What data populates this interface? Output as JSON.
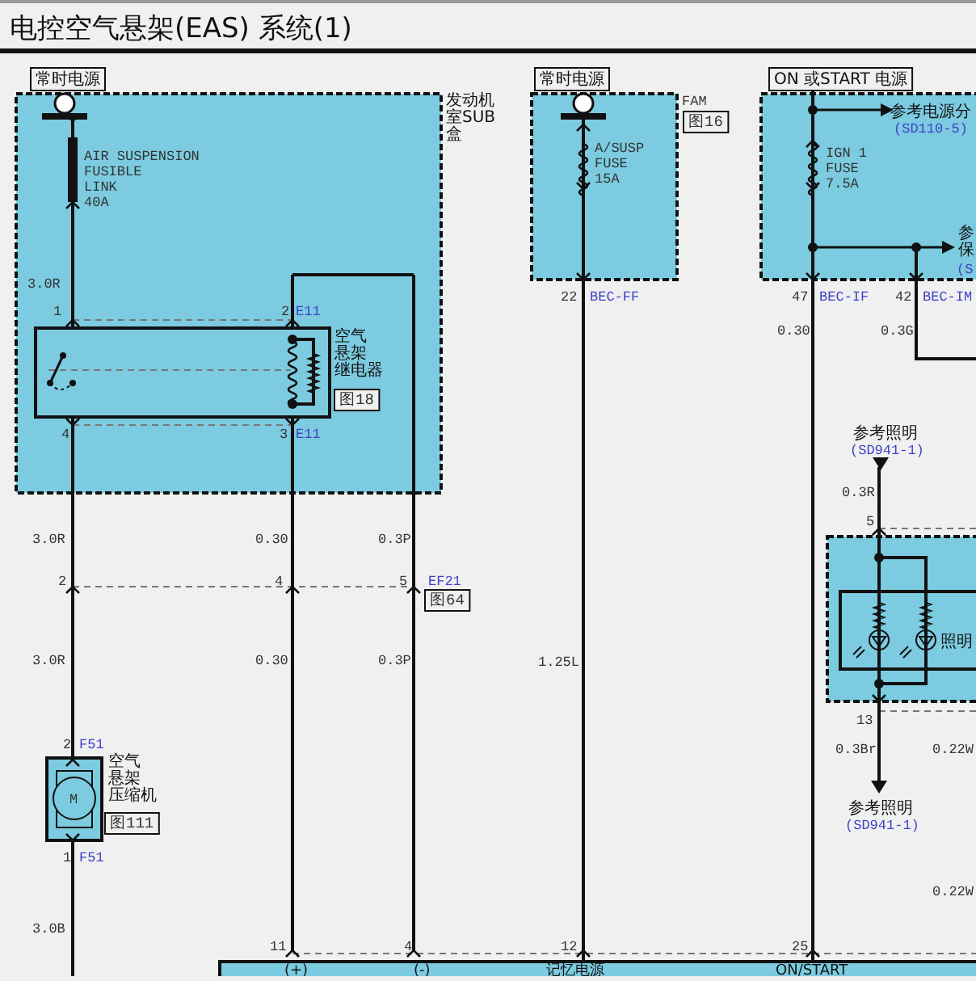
{
  "title": "电控空气悬架(EAS)  系统(1)",
  "labels": [
    {
      "kind": "power",
      "text": "常时电源"
    },
    {
      "kind": "power",
      "text": "常时电源"
    },
    {
      "kind": "power",
      "text": "ON 或START 电源"
    },
    {
      "kind": "part",
      "lines": [
        "发动机",
        "室SUB",
        "盒"
      ]
    },
    {
      "kind": "note",
      "text": "FAM"
    },
    {
      "kind": "ref",
      "text": "图16"
    },
    {
      "kind": "link",
      "text": "参考电源分"
    },
    {
      "kind": "connector",
      "text": "(SD110-5)"
    },
    {
      "kind": "note",
      "lines": [
        "AIR SUSPENSION",
        "FUSIBLE",
        "LINK",
        "40A"
      ]
    },
    {
      "kind": "note",
      "lines": [
        "A/SUSP",
        "FUSE",
        "15A"
      ]
    },
    {
      "kind": "note",
      "lines": [
        "IGN 1",
        "FUSE",
        "7.5A"
      ]
    },
    {
      "kind": "link",
      "lines": [
        "参",
        "保"
      ]
    },
    {
      "kind": "connector",
      "text": "(S"
    },
    {
      "kind": "gauge",
      "text": "3.0R"
    },
    {
      "kind": "pin",
      "text": "1"
    },
    {
      "kind": "pin",
      "text": "2"
    },
    {
      "kind": "connector",
      "text": "E11"
    },
    {
      "kind": "part",
      "lines": [
        "空气",
        "悬架",
        "继电器"
      ]
    },
    {
      "kind": "ref",
      "text": "图18"
    },
    {
      "kind": "pin",
      "text": "22"
    },
    {
      "kind": "connector",
      "text": "BEC-FF"
    },
    {
      "kind": "pin",
      "text": "47"
    },
    {
      "kind": "connector",
      "text": "BEC-IF"
    },
    {
      "kind": "pin",
      "text": "42"
    },
    {
      "kind": "connector",
      "text": "BEC-IM"
    },
    {
      "kind": "gauge",
      "text": "0.30"
    },
    {
      "kind": "gauge",
      "text": "0.3G"
    },
    {
      "kind": "pin",
      "text": "4"
    },
    {
      "kind": "pin",
      "text": "3"
    },
    {
      "kind": "connector",
      "text": "E11"
    },
    {
      "kind": "link",
      "text": "参考照明"
    },
    {
      "kind": "connector",
      "text": "(SD941-1)"
    },
    {
      "kind": "gauge",
      "text": "0.3R"
    },
    {
      "kind": "pin",
      "text": "5"
    },
    {
      "kind": "gauge",
      "text": "3.0R"
    },
    {
      "kind": "gauge",
      "text": "0.30"
    },
    {
      "kind": "gauge",
      "text": "0.3P"
    },
    {
      "kind": "pin",
      "text": "2"
    },
    {
      "kind": "pin",
      "text": "4"
    },
    {
      "kind": "pin",
      "text": "5"
    },
    {
      "kind": "connector",
      "text": "EF21"
    },
    {
      "kind": "ref",
      "text": "图64"
    },
    {
      "kind": "part",
      "text": "照明"
    },
    {
      "kind": "gauge",
      "text": "3.0R"
    },
    {
      "kind": "gauge",
      "text": "0.30"
    },
    {
      "kind": "gauge",
      "text": "0.3P"
    },
    {
      "kind": "gauge",
      "text": "1.25L"
    },
    {
      "kind": "pin",
      "text": "13"
    },
    {
      "kind": "pin",
      "text": "2"
    },
    {
      "kind": "connector",
      "text": "F51"
    },
    {
      "kind": "gauge",
      "text": "0.3Br"
    },
    {
      "kind": "gauge",
      "text": "0.22W"
    },
    {
      "kind": "motor",
      "text": "M"
    },
    {
      "kind": "part",
      "lines": [
        "空气",
        "悬架",
        "压缩机"
      ]
    },
    {
      "kind": "ref",
      "text": "图111"
    },
    {
      "kind": "link",
      "text": "参考照明"
    },
    {
      "kind": "connector",
      "text": "(SD941-1)"
    },
    {
      "kind": "pin",
      "text": "1"
    },
    {
      "kind": "connector",
      "text": "F51"
    },
    {
      "kind": "gauge",
      "text": "0.22W"
    },
    {
      "kind": "gauge",
      "text": "3.0B"
    },
    {
      "kind": "pin",
      "text": "11"
    },
    {
      "kind": "pin",
      "text": "4"
    },
    {
      "kind": "pin",
      "text": "12"
    },
    {
      "kind": "pin",
      "text": "25"
    },
    {
      "kind": "bus",
      "text": "(+)"
    },
    {
      "kind": "bus",
      "text": "(-)"
    },
    {
      "kind": "bus",
      "text": "记忆电源"
    },
    {
      "kind": "bus",
      "text": "ON/START"
    }
  ]
}
